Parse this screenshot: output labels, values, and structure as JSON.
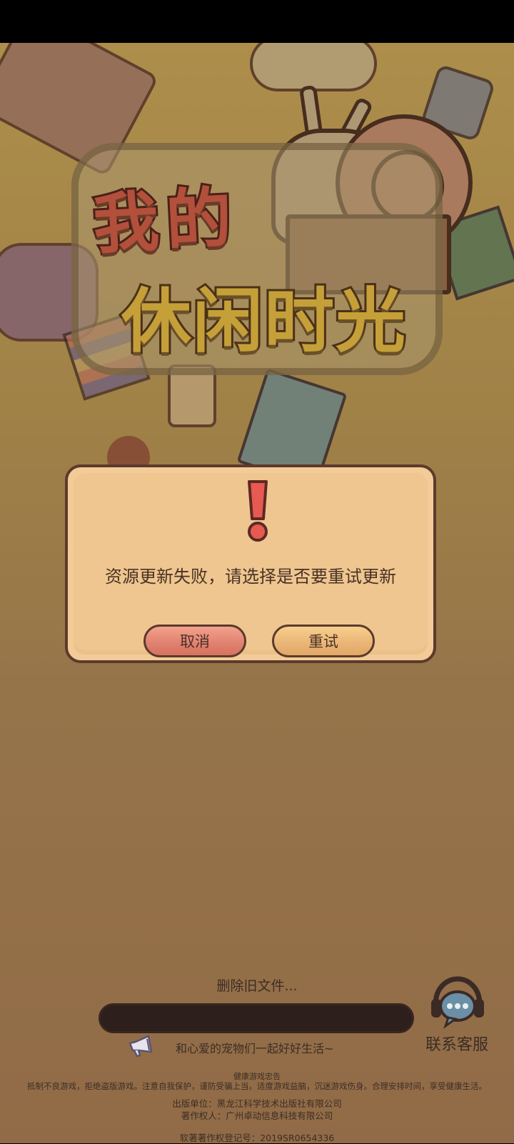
{
  "game": {
    "logo_line1": "我的",
    "logo_line2": "休闲时光"
  },
  "dialog": {
    "message": "资源更新失败，请选择是否要重试更新",
    "cancel_label": "取消",
    "retry_label": "重试"
  },
  "loading": {
    "status_text": "删除旧文件...",
    "progress_fraction": 0
  },
  "tagline": "和心爱的宠物们一起好好生活~",
  "support": {
    "label": "联系客服"
  },
  "footer": {
    "title": "健康游戏忠告",
    "advice": "抵制不良游戏，拒绝盗版游戏。注意自我保护，谨防受骗上当。适度游戏益脑，沉迷游戏伤身。合理安排时间，享受健康生活。",
    "publisher": "出版单位：黑龙江科学技术出版社有限公司",
    "copyright_owner": "著作权人：广州卓动信息科技有限公司",
    "registration": "软著著作权登记号：2019SR0654336"
  },
  "icons": {
    "alert": "exclamation-icon",
    "speaker": "megaphone-icon",
    "support": "headset-chat-icon"
  }
}
